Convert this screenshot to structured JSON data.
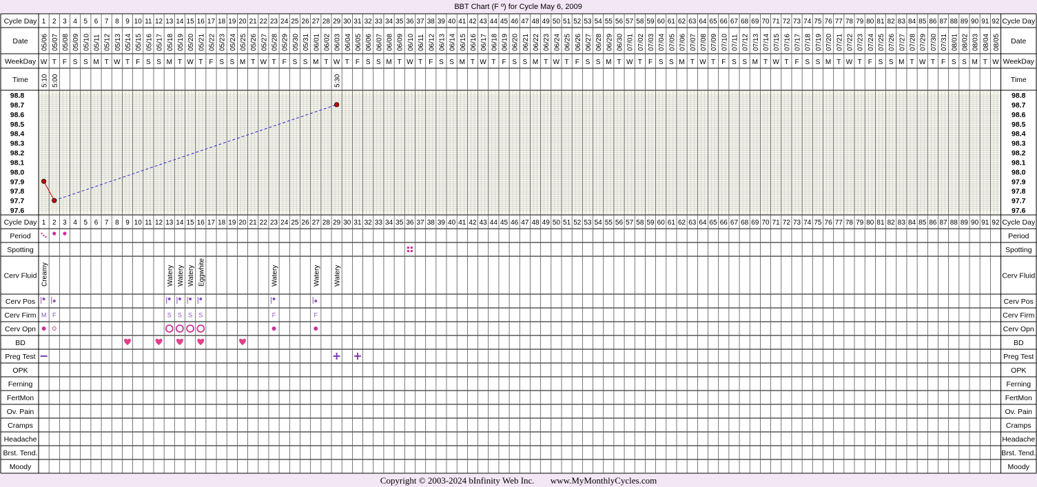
{
  "title": "BBT Chart (F º) for Cycle May 6, 2009",
  "row_labels": {
    "cycle_day": "Cycle Day",
    "date": "Date",
    "weekday": "WeekDay",
    "time": "Time",
    "period": "Period",
    "spotting": "Spotting",
    "cerv_fluid": "Cerv Fluid",
    "cerv_pos": "Cerv Pos",
    "cerv_firm": "Cerv Firm",
    "cerv_opn": "Cerv Opn",
    "bd": "BD",
    "preg_test": "Preg Test",
    "opk": "OPK",
    "ferning": "Ferning",
    "fertmon": "FertMon",
    "ov_pain": "Ov. Pain",
    "cramps": "Cramps",
    "headache": "Headache",
    "brst_tend": "Brst. Tend.",
    "moody": "Moody"
  },
  "days": 92,
  "start_date": "2009-05-06",
  "weekday_letters": [
    "W",
    "T",
    "F",
    "S",
    "S",
    "M",
    "T"
  ],
  "times": {
    "1": "5:10",
    "2": "5:00",
    "29": "5:30"
  },
  "temp_axis": {
    "labels": [
      "98.8",
      "98.7",
      "98.6",
      "98.5",
      "98.4",
      "98.3",
      "98.2",
      "98.1",
      "98.0",
      "97.9",
      "97.8",
      "97.7",
      "97.6"
    ],
    "min": 97.6,
    "max": 98.8,
    "step": 0.1,
    "minor": 0.02
  },
  "chart_data": {
    "type": "line",
    "title": "BBT Chart (F º) for Cycle May 6, 2009",
    "xlabel": "Cycle Day",
    "ylabel": "",
    "ylim": [
      97.6,
      98.8
    ],
    "series": [
      {
        "x": [
          1,
          2,
          29
        ],
        "y": [
          97.9,
          97.7,
          98.7
        ]
      }
    ],
    "connections": [
      {
        "from": 1,
        "to": 2,
        "style": "solid"
      },
      {
        "from": 2,
        "to": 29,
        "style": "dashed"
      }
    ]
  },
  "period": {
    "1": "spotting-dots",
    "2": "dot",
    "3": "dot"
  },
  "spotting": {
    "36": "four-dots"
  },
  "cerv_fluid": {
    "1": "Creamy",
    "13": "Watery",
    "14": "Watery",
    "15": "Watery",
    "16": "Eggwhite",
    "23": "Watery",
    "27": "Watery",
    "29": "Watery"
  },
  "cerv_pos": {
    "1": "high",
    "2": "mid",
    "13": "high",
    "14": "high",
    "15": "high",
    "16": "high",
    "23": "high",
    "27": "mid"
  },
  "cerv_firm": {
    "1": "M",
    "2": "F",
    "13": "S",
    "14": "S",
    "15": "S",
    "16": "S",
    "23": "F",
    "27": "F"
  },
  "cerv_opn": {
    "1": "small-filled",
    "2": "small-open",
    "13": "large-open",
    "14": "large-open",
    "15": "large-open",
    "16": "large-open",
    "23": "small-filled",
    "27": "small-filled"
  },
  "bd": [
    9,
    12,
    14,
    16,
    20
  ],
  "preg_test": {
    "1": "negative",
    "29": "positive",
    "31": "positive"
  },
  "copyright": "Copyright © 2003-2024 bInfinity Web Inc.",
  "site": "www.MyMonthlyCycles.com",
  "colors": {
    "background": "#f3e6f5",
    "grid_bg": "#f5f5ea",
    "grid_line": "#cccccc",
    "cell_line": "#000000",
    "temp_point": "#cc0000",
    "solid_line": "#cc0000",
    "dashed_line": "#2222cc",
    "marker": "#cc3399",
    "heart": "#e0408a",
    "preg_sign": "#7b3fb8",
    "cerv_pos": "#8a4fbf"
  }
}
